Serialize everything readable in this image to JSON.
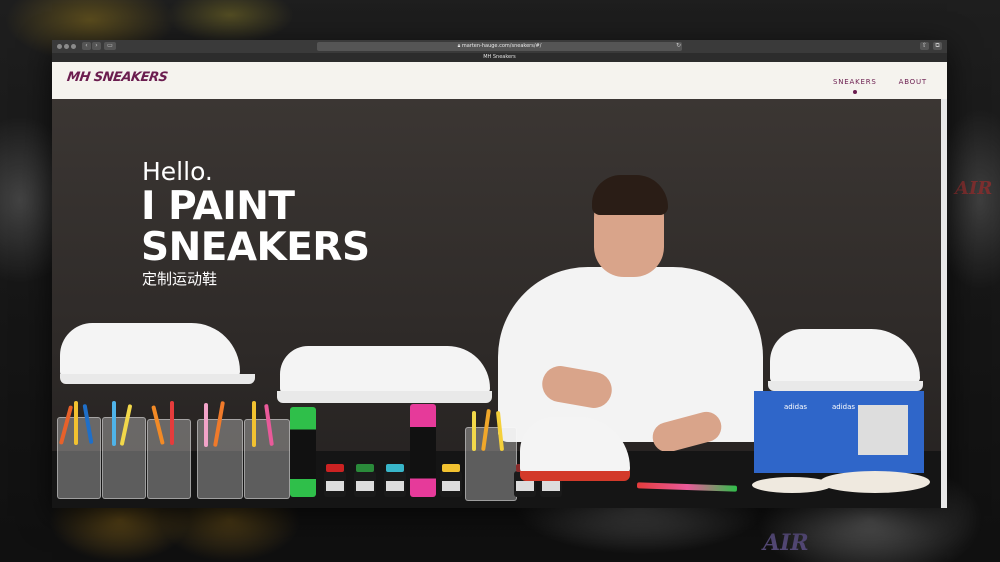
{
  "browser": {
    "url": "marten-hauge.com/sneakers/#/",
    "tab_title": "MH Sneakers"
  },
  "site": {
    "logo_text": "MH SNEAKERS",
    "nav": [
      {
        "label": "SNEAKERS",
        "active": true
      },
      {
        "label": "ABOUT",
        "active": false
      }
    ]
  },
  "hero": {
    "greeting": "Hello.",
    "headline_line1": "I PAINT",
    "headline_line2": "SNEAKERS",
    "subtitle": "定制运动鞋"
  },
  "photo": {
    "box_brand": "adidas",
    "background_text": "AIR"
  },
  "colors": {
    "brand": "#6b1d4f",
    "hero_bg": "#2e2a28",
    "header_bg": "#f5f3ee",
    "box_blue": "#2f66c9"
  }
}
